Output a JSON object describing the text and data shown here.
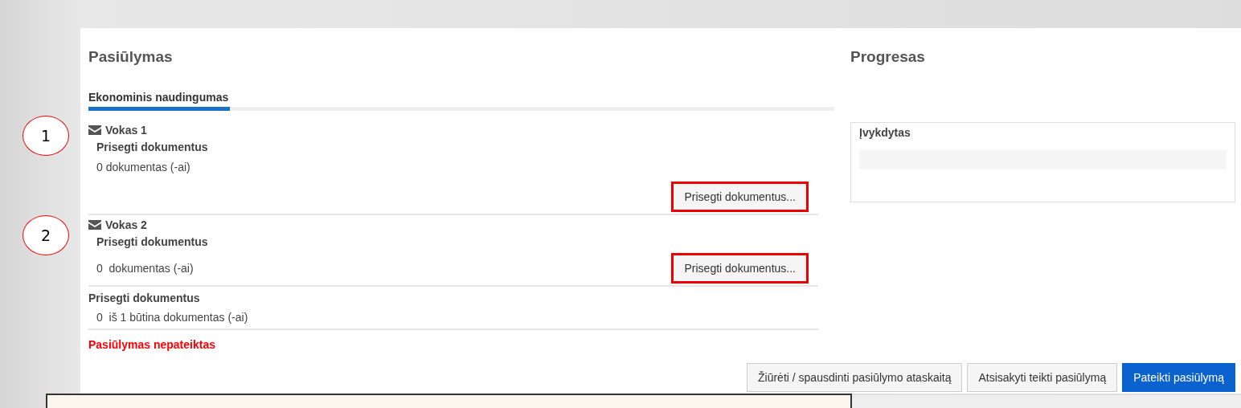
{
  "offer": {
    "title": "Pasiūlymas",
    "tabs": [
      {
        "label": "Ekonominis naudingumas",
        "selected": true
      }
    ],
    "envelopes": [
      {
        "marker": "1",
        "title": "Vokas 1",
        "section_title": "Prisegti dokumentus",
        "count": "0 dokumentas (-ai)",
        "button": "Prisegti dokumentus...",
        "highlighted": true,
        "kind": "stacked"
      },
      {
        "marker": "2",
        "title": "Vokas 2",
        "section_title": "Prisegti dokumentus",
        "count": "0  dokumentas (-ai)",
        "button": "Prisegti dokumentus...",
        "highlighted": true,
        "kind": "inline"
      }
    ],
    "summary": {
      "title": "Prisegti dokumentus",
      "count": "0  iš 1 būtina dokumentas (-ai)"
    },
    "status": "Pasiūlymas nepateiktas",
    "actions": [
      {
        "label": "Žiūrėti / spausdinti pasiūlymo ataskaitą",
        "kind": "default"
      },
      {
        "label": "Atsisakyti teikti pasiūlymą",
        "kind": "default"
      },
      {
        "label": "Pateikti pasiūlymą",
        "kind": "primary"
      }
    ]
  },
  "progress": {
    "title": "Progresas",
    "label": "Įvykdytas"
  }
}
